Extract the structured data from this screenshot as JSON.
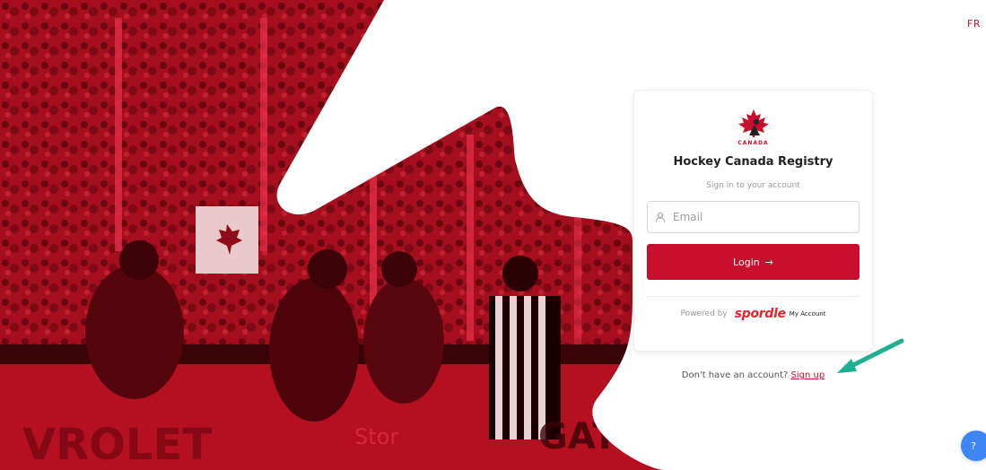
{
  "lang_toggle": "FR",
  "login_card": {
    "logo_text": "CANADA",
    "title": "Hockey Canada Registry",
    "subtitle": "Sign in to your account",
    "email_placeholder": "Email",
    "login_label": "Login",
    "login_arrow": "→",
    "powered_by": "Powered by",
    "spordle": "spordle",
    "my_account": "My Account"
  },
  "signup": {
    "prompt": "Don't have an account?",
    "link": "Sign up"
  },
  "help_label": "?",
  "colors": {
    "brand_red": "#c8102e",
    "help_blue": "#3e86f5",
    "annotation_arrow": "#1fae8f"
  },
  "icons": {
    "email": "user-icon",
    "login": "arrow-right-icon",
    "logo": "hockey-canada-maple-leaf-logo"
  }
}
